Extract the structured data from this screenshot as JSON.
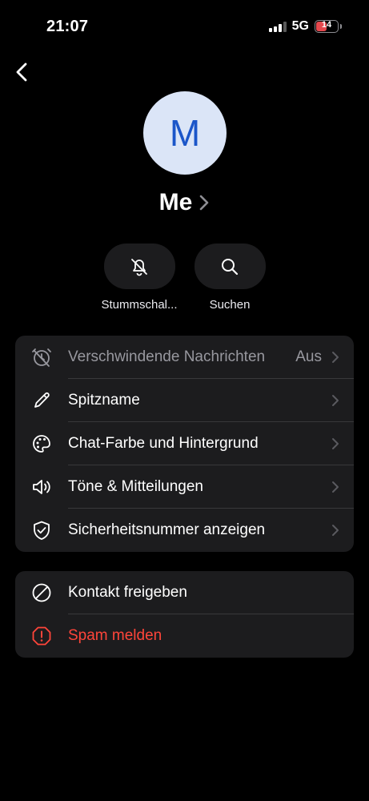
{
  "status_bar": {
    "time": "21:07",
    "network": "5G",
    "battery": "14",
    "battery_color": "#e5484d"
  },
  "header": {
    "back_icon": "chevron-left-icon"
  },
  "profile": {
    "avatar_letter": "M",
    "avatar_bg": "#dbe5f7",
    "avatar_fg": "#1b56c9",
    "name": "Me"
  },
  "quick_actions": [
    {
      "label": "Stummschal...",
      "icon": "bell-slash-icon"
    },
    {
      "label": "Suchen",
      "icon": "search-icon"
    }
  ],
  "settings_group": [
    {
      "label": "Verschwindende Nachrichten",
      "value": "Aus",
      "icon": "timer-off-icon"
    },
    {
      "label": "Spitzname",
      "icon": "pencil-icon"
    },
    {
      "label": "Chat-Farbe und Hintergrund",
      "icon": "palette-icon"
    },
    {
      "label": "Töne & Mitteilungen",
      "icon": "speaker-icon"
    },
    {
      "label": "Sicherheitsnummer anzeigen",
      "icon": "shield-check-icon"
    }
  ],
  "actions_group": [
    {
      "label": "Kontakt freigeben",
      "icon": "block-icon"
    },
    {
      "label": "Spam melden",
      "icon": "alert-octagon-icon",
      "color": "#ff453a"
    }
  ]
}
